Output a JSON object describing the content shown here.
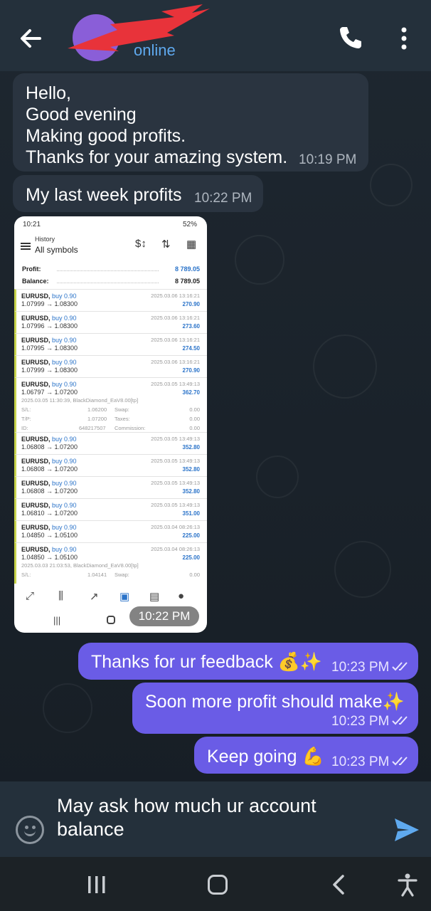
{
  "header": {
    "contact_name": "",
    "status": "online"
  },
  "messages": {
    "m1": {
      "text": "Hello,\nGood evening\nMaking good profits.\nThanks for your amazing system.",
      "time": "10:19 PM"
    },
    "m2": {
      "text": "My last week profits",
      "time": "10:22 PM"
    },
    "image_time": "10:22 PM",
    "m4": {
      "text": "Thanks for ur feedback 💰✨",
      "time": "10:23 PM"
    },
    "m5": {
      "text": "Soon more profit should make✨",
      "time": "10:23 PM"
    },
    "m6": {
      "text": "Keep going 💪",
      "time": "10:23 PM"
    }
  },
  "screenshot": {
    "status_time": "10:21",
    "status_right": "52%",
    "history_label": "History",
    "filter_label": "All symbols",
    "profit_label": "Profit:",
    "profit_value": "8 789.05",
    "balance_label": "Balance:",
    "balance_value": "8 789.05",
    "rows": [
      {
        "symbol": "EURUSD,",
        "side": "buy 0.90",
        "prices": "1.07999 → 1.08300",
        "date": "2025.03.06 13:16:21",
        "profit": "270.90"
      },
      {
        "symbol": "EURUSD,",
        "side": "buy 0.90",
        "prices": "1.07996 → 1.08300",
        "date": "2025.03.06 13:16:21",
        "profit": "273.60"
      },
      {
        "symbol": "EURUSD,",
        "side": "buy 0.90",
        "prices": "1.07995 → 1.08300",
        "date": "2025.03.06 13:16:21",
        "profit": "274.50"
      },
      {
        "symbol": "EURUSD,",
        "side": "buy 0.90",
        "prices": "1.07999 → 1.08300",
        "date": "2025.03.06 13:16:21",
        "profit": "270.90"
      },
      {
        "symbol": "EURUSD,",
        "side": "buy 0.90",
        "prices": "1.06797 → 1.07200",
        "date": "2025.03.05 13:49:13",
        "profit": "362.70"
      },
      {
        "symbol": "EURUSD,",
        "side": "buy 0.90",
        "prices": "1.06808 → 1.07200",
        "date": "2025.03.05 13:49:13",
        "profit": "352.80"
      },
      {
        "symbol": "EURUSD,",
        "side": "buy 0.90",
        "prices": "1.06808 → 1.07200",
        "date": "2025.03.05 13:49:13",
        "profit": "352.80"
      },
      {
        "symbol": "EURUSD,",
        "side": "buy 0.90",
        "prices": "1.06808 → 1.07200",
        "date": "2025.03.05 13:49:13",
        "profit": "352.80"
      },
      {
        "symbol": "EURUSD,",
        "side": "buy 0.90",
        "prices": "1.06810 → 1.07200",
        "date": "2025.03.05 13:49:13",
        "profit": "351.00"
      },
      {
        "symbol": "EURUSD,",
        "side": "buy 0.90",
        "prices": "1.04850 → 1.05100",
        "date": "2025.03.04 08:26:13",
        "profit": "225.00"
      },
      {
        "symbol": "EURUSD,",
        "side": "buy 0.90",
        "prices": "1.04850 → 1.05100",
        "date": "2025.03.04 08:26:13",
        "profit": "225.00"
      }
    ],
    "detail1": {
      "opened": "2025.03.05 11:30:39, BlackDiamond_EaV8.00[tp]",
      "sl_label": "S/L:",
      "sl_value": "1.06200",
      "tp_label": "T/P:",
      "tp_value": "1.07200",
      "id_label": "ID:",
      "id_value": "648217507",
      "swap_label": "Swap:",
      "swap_value": "0.00",
      "taxes_label": "Taxes:",
      "taxes_value": "0.00",
      "commission_label": "Commission:",
      "commission_value": "0.00"
    },
    "detail2": {
      "opened": "2025.03.03 21:03:53, BlackDiamond_EaV8.00[tp]",
      "sl_label": "S/L:",
      "sl_value": "1.04141",
      "swap_label": "Swap:",
      "swap_value": "0.00"
    }
  },
  "composer": {
    "draft": "May ask how much ur account balance"
  },
  "colors": {
    "outgoing_bubble": "#6a5ce6",
    "incoming_bubble": "#2a3440",
    "accent": "#5fa9ee"
  }
}
